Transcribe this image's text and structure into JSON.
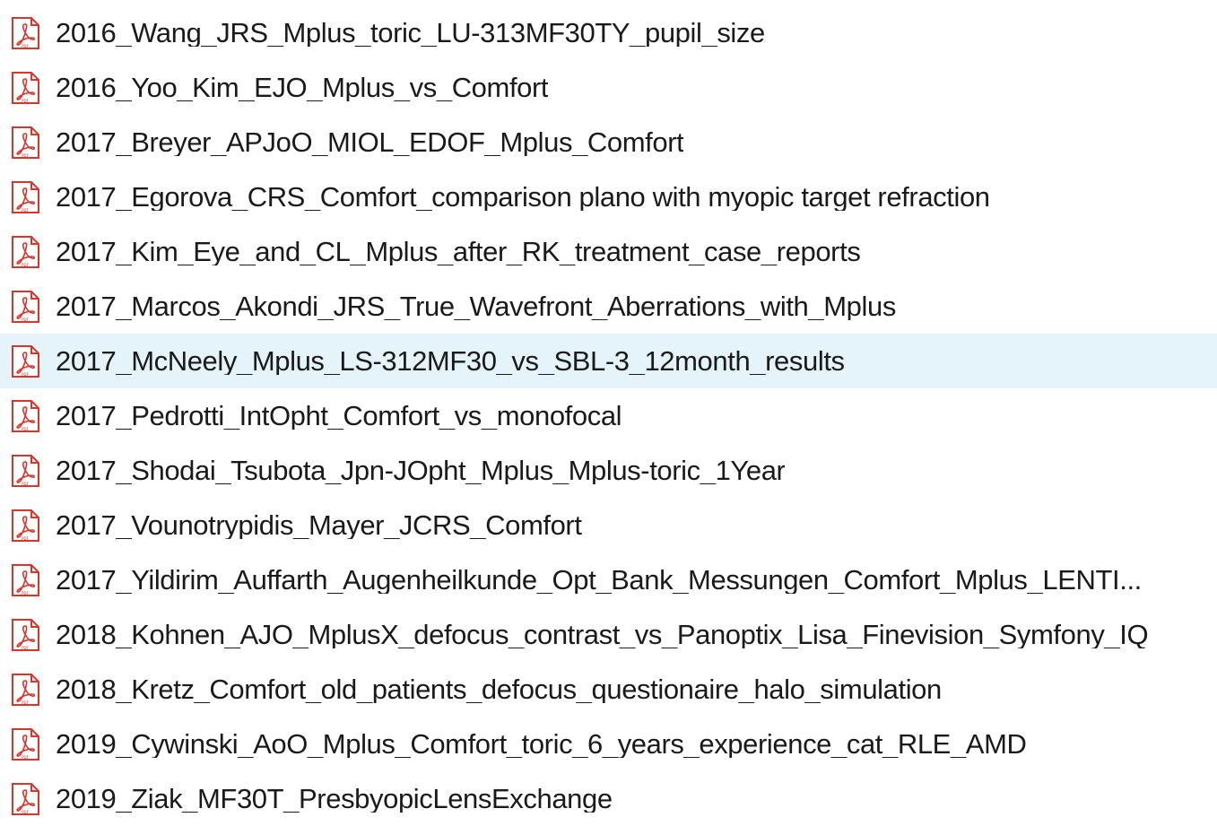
{
  "file_list": {
    "items": [
      {
        "name": "2016_Wang_JRS_Mplus_toric_LU-313MF30TY_pupil_size",
        "selected": false,
        "icon": "pdf-file-icon"
      },
      {
        "name": "2016_Yoo_Kim_EJO_Mplus_vs_Comfort",
        "selected": false,
        "icon": "pdf-file-icon"
      },
      {
        "name": "2017_Breyer_APJoO_MIOL_EDOF_Mplus_Comfort",
        "selected": false,
        "icon": "pdf-file-icon"
      },
      {
        "name": "2017_Egorova_CRS_Comfort_comparison plano with myopic target refraction",
        "selected": false,
        "icon": "pdf-file-icon"
      },
      {
        "name": "2017_Kim_Eye_and_CL_Mplus_after_RK_treatment_case_reports",
        "selected": false,
        "icon": "pdf-file-icon"
      },
      {
        "name": "2017_Marcos_Akondi_JRS_True_Wavefront_Aberrations_with_Mplus",
        "selected": false,
        "icon": "pdf-file-icon"
      },
      {
        "name": "2017_McNeely_Mplus_LS-312MF30_vs_SBL-3_12month_results",
        "selected": true,
        "icon": "pdf-file-icon"
      },
      {
        "name": "2017_Pedrotti_IntOpht_Comfort_vs_monofocal",
        "selected": false,
        "icon": "pdf-file-icon"
      },
      {
        "name": "2017_Shodai_Tsubota_Jpn-JOpht_Mplus_Mplus-toric_1Year",
        "selected": false,
        "icon": "pdf-file-icon"
      },
      {
        "name": "2017_Vounotrypidis_Mayer_JCRS_Comfort",
        "selected": false,
        "icon": "pdf-file-icon"
      },
      {
        "name": "2017_Yildirim_Auffarth_Augenheilkunde_Opt_Bank_Messungen_Comfort_Mplus_LENTI...",
        "selected": false,
        "icon": "pdf-file-icon"
      },
      {
        "name": "2018_Kohnen_AJO_MplusX_defocus_contrast_vs_Panoptix_Lisa_Finevision_Symfony_IQ",
        "selected": false,
        "icon": "pdf-file-icon"
      },
      {
        "name": "2018_Kretz_Comfort_old_patients_defocus_questionaire_halo_simulation",
        "selected": false,
        "icon": "pdf-file-icon"
      },
      {
        "name": "2019_Cywinski_AoO_Mplus_Comfort_toric_6_years_experience_cat_RLE_AMD",
        "selected": false,
        "icon": "pdf-file-icon"
      },
      {
        "name": "2019_Ziak_MF30T_PresbyopicLensExchange",
        "selected": false,
        "icon": "pdf-file-icon"
      }
    ]
  },
  "colors": {
    "selection_background": "#e5f3fb",
    "text": "#1a1a1a",
    "pdf_red": "#d9352b"
  }
}
